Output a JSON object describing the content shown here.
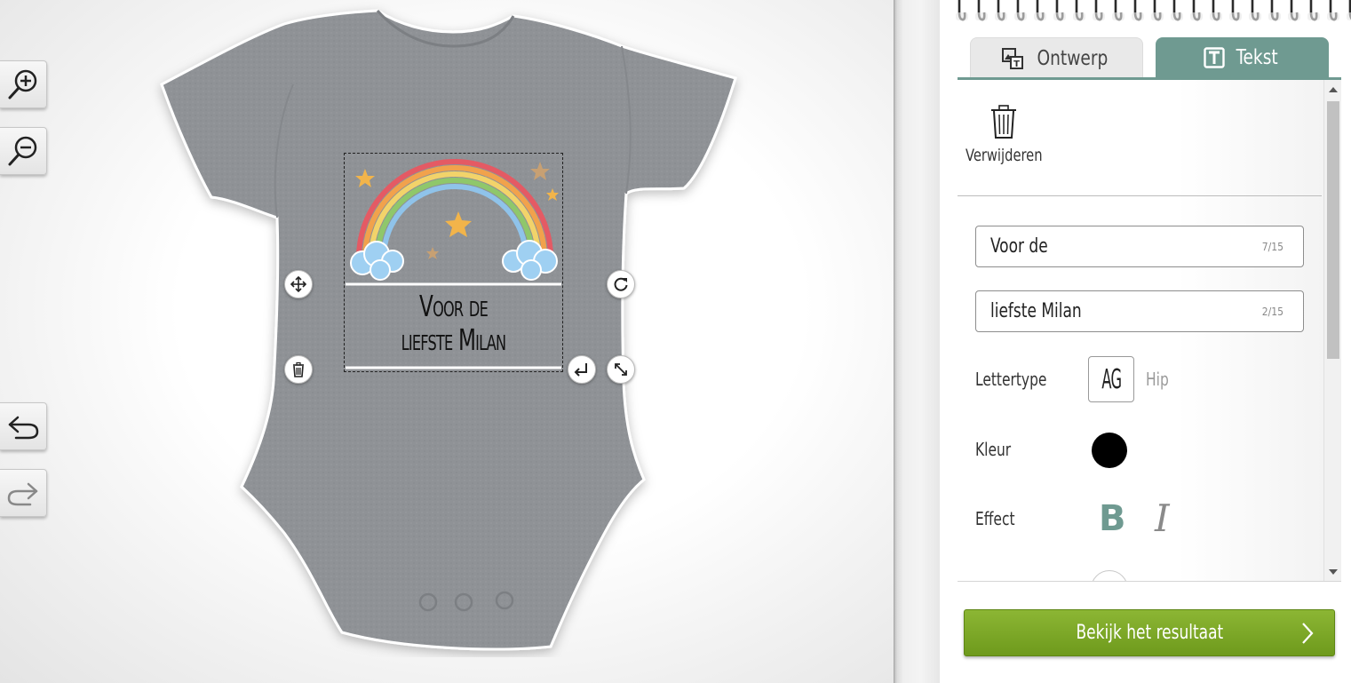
{
  "canvas": {
    "tools": {
      "zoom_in": "zoom-in-icon",
      "zoom_out": "zoom-out-icon",
      "undo": "undo-icon",
      "redo": "redo-icon"
    },
    "product_color": "#8f9296",
    "design": {
      "text_line_1": "Voor de",
      "text_line_2": "liefste Milan"
    }
  },
  "panel": {
    "tabs": [
      {
        "label": "Ontwerp",
        "icon": "image-text-icon",
        "active": false
      },
      {
        "label": "Tekst",
        "icon": "text-t-icon",
        "active": true
      }
    ],
    "delete_label": "Verwijderen",
    "fields": [
      {
        "value": "Voor de",
        "counter": "7/15"
      },
      {
        "value": "liefste Milan",
        "counter": "2/15"
      }
    ],
    "font": {
      "label": "Lettertype",
      "sample": "AG",
      "name": "Hip"
    },
    "color": {
      "label": "Kleur",
      "value": "#000000"
    },
    "effect": {
      "label": "Effect",
      "bold": "B",
      "italic": "I",
      "bold_active": true
    },
    "result_button": "Bekijk het resultaat",
    "accent_color": "#6f9a91",
    "button_color": "#7ba62a"
  }
}
